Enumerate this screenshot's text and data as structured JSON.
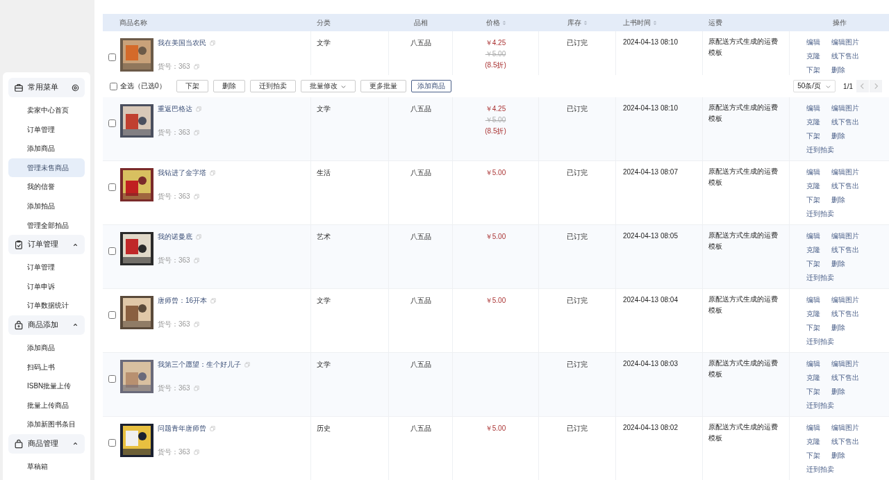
{
  "sidebar": {
    "groups": [
      {
        "title": "常用菜单",
        "expanded": true,
        "items": [
          {
            "label": "卖家中心首页",
            "selected": false
          },
          {
            "label": "订单管理",
            "selected": false
          },
          {
            "label": "添加商品",
            "selected": false
          },
          {
            "label": "管理未售商品",
            "selected": true
          },
          {
            "label": "我的信誉",
            "selected": false
          },
          {
            "label": "添加拍品",
            "selected": false
          },
          {
            "label": "管理全部拍品",
            "selected": false
          }
        ]
      },
      {
        "title": "订单管理",
        "expanded": true,
        "items": [
          {
            "label": "订单管理",
            "selected": false
          },
          {
            "label": "订单申诉",
            "selected": false
          },
          {
            "label": "订单数据统计",
            "selected": false
          }
        ]
      },
      {
        "title": "商品添加",
        "expanded": true,
        "items": [
          {
            "label": "添加商品",
            "selected": false
          },
          {
            "label": "扫码上书",
            "selected": false
          },
          {
            "label": "ISBN批量上传",
            "selected": false
          },
          {
            "label": "批量上传商品",
            "selected": false
          },
          {
            "label": "添加新图书条目",
            "selected": false
          }
        ]
      },
      {
        "title": "商品管理",
        "expanded": true,
        "items": [
          {
            "label": "草稿箱",
            "selected": false
          }
        ]
      }
    ]
  },
  "table": {
    "columns": [
      {
        "label": "商品名称",
        "sortable": false
      },
      {
        "label": "分类",
        "sortable": false
      },
      {
        "label": "品相",
        "sortable": false
      },
      {
        "label": "价格",
        "sortable": true
      },
      {
        "label": "库存",
        "sortable": true
      },
      {
        "label": "上书时间",
        "sortable": true
      },
      {
        "label": "运费",
        "sortable": false
      },
      {
        "label": "操作",
        "sortable": false
      }
    ],
    "rows": [
      {
        "checked": false,
        "title": "我在美国当农民",
        "sku": "货号：363",
        "category": "文学",
        "condition": "八五品",
        "price": "￥4.25",
        "original_price": "￥5.00",
        "discount": "(8.5折)",
        "stock": "已订完",
        "listed": "2024-04-13 08:10",
        "shipping": "原配送方式生成的运费模板",
        "actions": [
          "编辑",
          "编辑图片",
          "克隆",
          "线下售出",
          "下架",
          "删除"
        ]
      },
      {
        "checked": false,
        "title": "重返巴格达",
        "sku": "货号：363",
        "category": "文学",
        "condition": "八五品",
        "price": "￥4.25",
        "original_price": "￥5.00",
        "discount": "(8.5折)",
        "stock": "已订完",
        "listed": "2024-04-13 08:10",
        "shipping": "原配送方式生成的运费模板",
        "actions": [
          "编辑",
          "编辑图片",
          "克隆",
          "线下售出",
          "下架",
          "删除",
          "迁到拍卖"
        ]
      },
      {
        "checked": false,
        "title": "我钻进了金字塔",
        "sku": "货号：363",
        "category": "生活",
        "condition": "八五品",
        "price": "￥5.00",
        "stock": "已订完",
        "listed": "2024-04-13 08:07",
        "shipping": "原配送方式生成的运费模板",
        "actions": [
          "编辑",
          "编辑图片",
          "克隆",
          "线下售出",
          "下架",
          "删除",
          "迁到拍卖"
        ]
      },
      {
        "checked": false,
        "title": "我的诺曼底",
        "sku": "货号：363",
        "category": "艺术",
        "condition": "八五品",
        "price": "￥5.00",
        "stock": "已订完",
        "listed": "2024-04-13 08:05",
        "shipping": "原配送方式生成的运费模板",
        "actions": [
          "编辑",
          "编辑图片",
          "克隆",
          "线下售出",
          "下架",
          "删除",
          "迁到拍卖"
        ]
      },
      {
        "checked": false,
        "title": "唐师曾：16开本",
        "sku": "货号：363",
        "category": "文学",
        "condition": "八五品",
        "price": "￥5.00",
        "stock": "已订完",
        "listed": "2024-04-13 08:04",
        "shipping": "原配送方式生成的运费模板",
        "actions": [
          "编辑",
          "编辑图片",
          "克隆",
          "线下售出",
          "下架",
          "删除",
          "迁到拍卖"
        ]
      },
      {
        "checked": false,
        "title": "我第三个愿望：生个好儿子",
        "sku": "货号：363",
        "category": "文学",
        "condition": "八五品",
        "stock": "已订完",
        "listed": "2024-04-13 08:03",
        "shipping": "原配送方式生成的运费模板",
        "actions": [
          "编辑",
          "编辑图片",
          "克隆",
          "线下售出",
          "下架",
          "删除",
          "迁到拍卖"
        ]
      },
      {
        "checked": false,
        "title": "问题青年唐师曾",
        "sku": "货号：363",
        "category": "历史",
        "condition": "八五品",
        "price": "￥5.00",
        "stock": "已订完",
        "listed": "2024-04-13 08:02",
        "shipping": "原配送方式生成的运费模板",
        "actions": [
          "编辑",
          "编辑图片",
          "克隆",
          "线下售出",
          "下架",
          "删除",
          "迁到拍卖"
        ]
      }
    ]
  },
  "batch_bar": {
    "select_all": {
      "label": "全选（已选0）",
      "checked": false
    },
    "buttons": [
      {
        "label": "下架",
        "kind": "plain"
      },
      {
        "label": "删除",
        "kind": "plain"
      },
      {
        "label": "迁到拍卖",
        "kind": "plain"
      },
      {
        "label": "批量修改",
        "kind": "dropdown"
      },
      {
        "label": "更多批量",
        "kind": "plain"
      },
      {
        "label": "添加商品",
        "kind": "primary"
      }
    ],
    "page_size": "50条/页",
    "page": "1/1",
    "prev_disabled": true,
    "next_disabled": true
  }
}
